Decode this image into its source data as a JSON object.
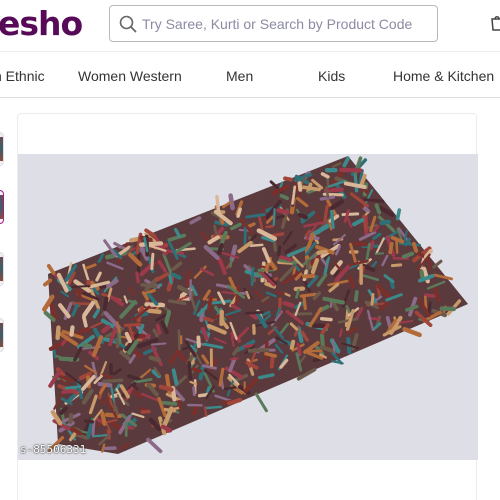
{
  "header": {
    "logo_text": "esho",
    "brand_color": "#570a57",
    "search": {
      "placeholder": "Try Saree, Kurti or Search by Product Code",
      "value": "",
      "icon": "search-icon"
    },
    "cart_icon": "cart-icon"
  },
  "categories": [
    {
      "label": "n Ethnic"
    },
    {
      "label": "Women Western"
    },
    {
      "label": "Men"
    },
    {
      "label": "Kids"
    },
    {
      "label": "Home & Kitchen"
    }
  ],
  "gallery": {
    "selected_thumbnail_index": 1,
    "thumbnail_count": 4,
    "accent_color": "#9f2089"
  },
  "product_image": {
    "code_label": "s-85506331",
    "description_icon": "shaggy-rug-image"
  }
}
